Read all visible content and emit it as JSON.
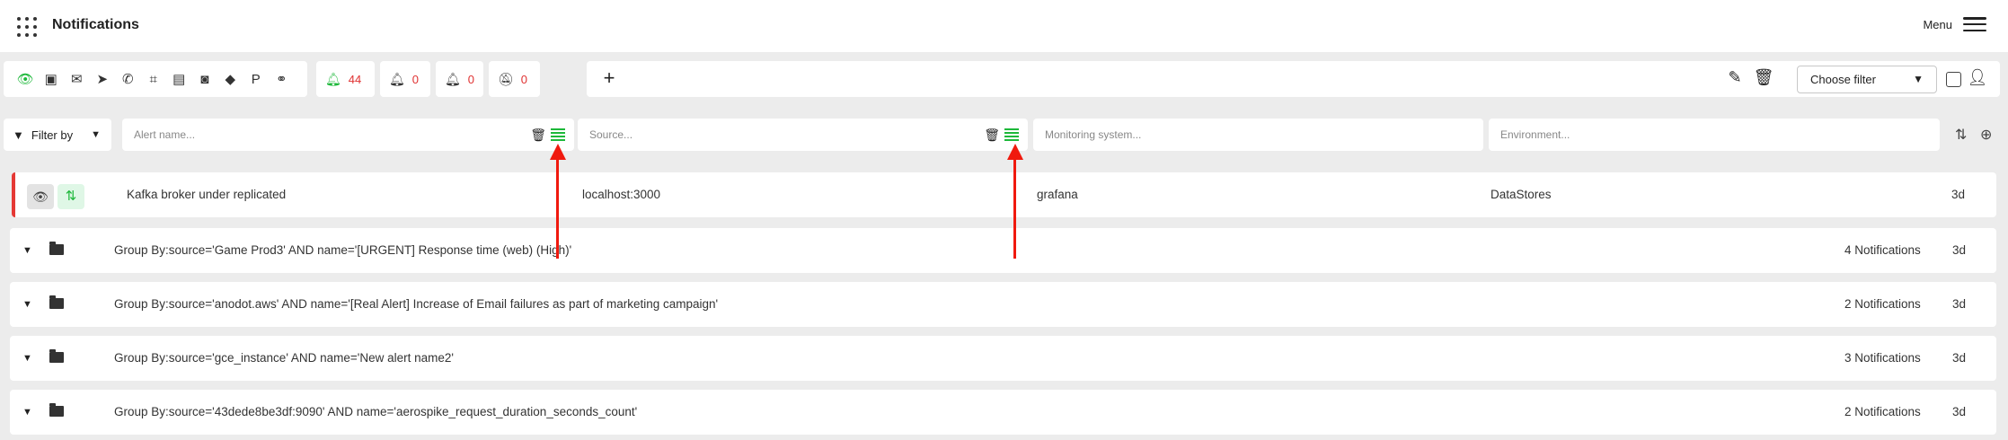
{
  "app": {
    "title": "Notifications",
    "menu_label": "Menu"
  },
  "channels": [
    "eye-icon",
    "teams-icon",
    "email-icon",
    "telegram-icon",
    "phone-icon",
    "slack-icon",
    "message-icon",
    "discord-icon",
    "git-icon",
    "pagerduty-icon",
    "webhook-icon"
  ],
  "counters": [
    {
      "name": "alerts-count",
      "icon": "bell-icon",
      "value": "44"
    },
    {
      "name": "acknowledged-count",
      "icon": "bell-check-icon",
      "value": "0"
    },
    {
      "name": "escalated-count",
      "icon": "bell-alert-icon",
      "value": "0"
    },
    {
      "name": "muted-count",
      "icon": "bell-off-icon",
      "value": "0"
    }
  ],
  "toolbar": {
    "add_symbol": "+",
    "choose_filter": "Choose filter"
  },
  "filters": {
    "filter_by": "Filter by",
    "alert_name_placeholder": "Alert name...",
    "source_placeholder": "Source...",
    "monitoring_placeholder": "Monitoring system...",
    "environment_placeholder": "Environment..."
  },
  "alert_row": {
    "name": "Kafka broker under replicated",
    "source": "localhost:3000",
    "monitoring": "grafana",
    "environment": "DataStores",
    "age": "3d"
  },
  "groups": [
    {
      "label": "Group By:source='Game Prod3' AND name='[URGENT] Response time (web) (High)'",
      "count": "4 Notifications",
      "age": "3d"
    },
    {
      "label": "Group By:source='anodot.aws' AND name='[Real Alert] Increase of Email failures as part of marketing campaign'",
      "count": "2 Notifications",
      "age": "3d"
    },
    {
      "label": "Group By:source='gce_instance' AND name='New alert name2'",
      "count": "3 Notifications",
      "age": "3d"
    },
    {
      "label": "Group By:source='43dede8be3df:9090' AND name='aerospike_request_duration_seconds_count'",
      "count": "2 Notifications",
      "age": "3d"
    }
  ],
  "colors": {
    "accent_green": "#1db83a",
    "alert_red": "#e53935",
    "annotation_arrow": "#f0190e"
  }
}
